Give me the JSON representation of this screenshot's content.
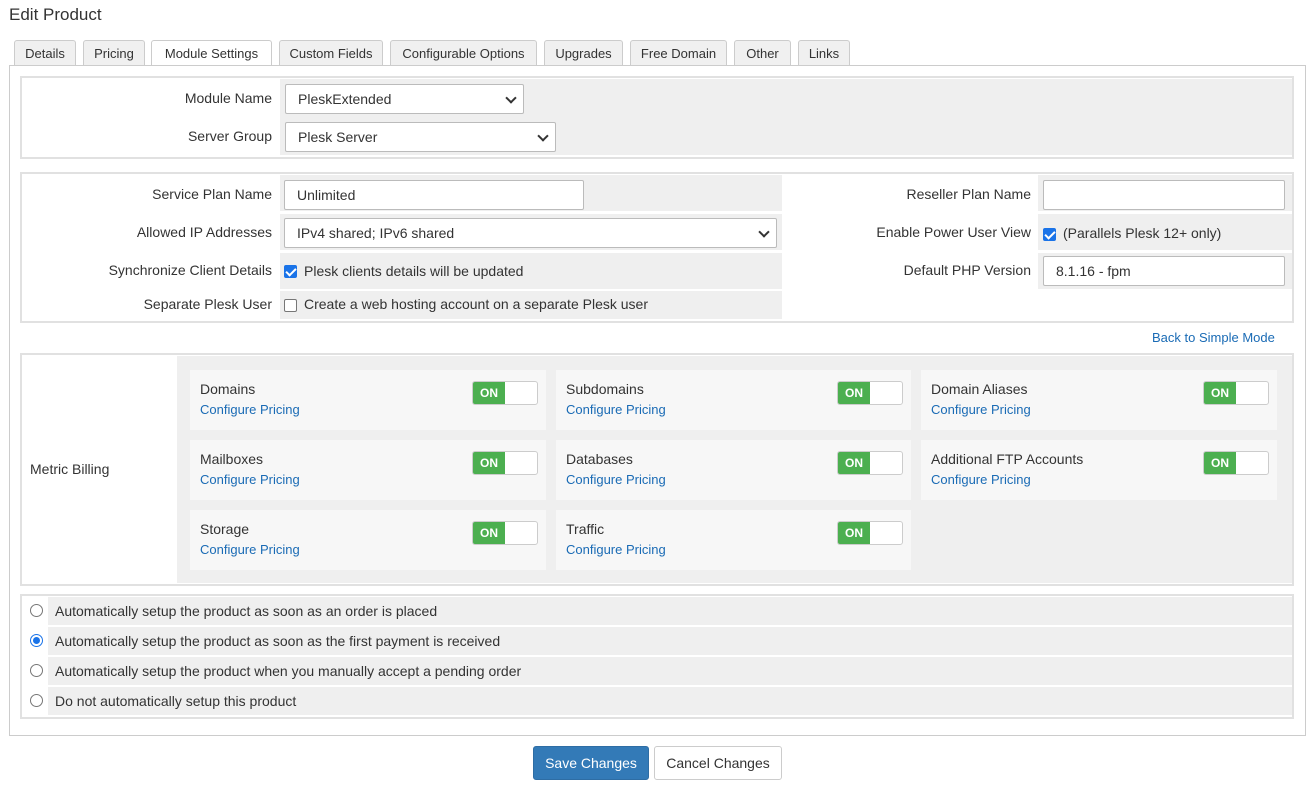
{
  "page_title": "Edit Product",
  "tabs": [
    "Details",
    "Pricing",
    "Module Settings",
    "Custom Fields",
    "Configurable Options",
    "Upgrades",
    "Free Domain",
    "Other",
    "Links"
  ],
  "active_tab": "Module Settings",
  "module": {
    "module_name_label": "Module Name",
    "module_name_value": "PleskExtended",
    "server_group_label": "Server Group",
    "server_group_value": "Plesk Server"
  },
  "settings": {
    "service_plan_label": "Service Plan Name",
    "service_plan_value": "Unlimited",
    "allowed_ip_label": "Allowed IP Addresses",
    "allowed_ip_value": "IPv4 shared; IPv6 shared",
    "sync_client_label": "Synchronize Client Details",
    "sync_client_text": "Plesk clients details will be updated",
    "sync_client_checked": true,
    "separate_user_label": "Separate Plesk User",
    "separate_user_text": "Create a web hosting account on a separate Plesk user",
    "separate_user_checked": false,
    "reseller_plan_label": "Reseller Plan Name",
    "reseller_plan_value": "",
    "power_user_label": "Enable Power User View",
    "power_user_text": "(Parallels Plesk 12+ only)",
    "power_user_checked": true,
    "php_version_label": "Default PHP Version",
    "php_version_value": "8.1.16 - fpm"
  },
  "back_link": "Back to Simple Mode",
  "metric_billing": {
    "label": "Metric Billing",
    "configure_label": "Configure Pricing",
    "toggle_label": "ON",
    "items": [
      {
        "name": "Domains",
        "enabled": true
      },
      {
        "name": "Subdomains",
        "enabled": true
      },
      {
        "name": "Domain Aliases",
        "enabled": true
      },
      {
        "name": "Mailboxes",
        "enabled": true
      },
      {
        "name": "Databases",
        "enabled": true
      },
      {
        "name": "Additional FTP Accounts",
        "enabled": true
      },
      {
        "name": "Storage",
        "enabled": true
      },
      {
        "name": "Traffic",
        "enabled": true
      }
    ]
  },
  "setup_options": {
    "selected_index": 1,
    "options": [
      "Automatically setup the product as soon as an order is placed",
      "Automatically setup the product as soon as the first payment is received",
      "Automatically setup the product when you manually accept a pending order",
      "Do not automatically setup this product"
    ]
  },
  "buttons": {
    "save": "Save Changes",
    "cancel": "Cancel Changes"
  },
  "colors": {
    "primary_button": "#337ab7",
    "toggle_on": "#4caf50",
    "link": "#1a6bb5",
    "checkbox": "#1a73e8"
  }
}
